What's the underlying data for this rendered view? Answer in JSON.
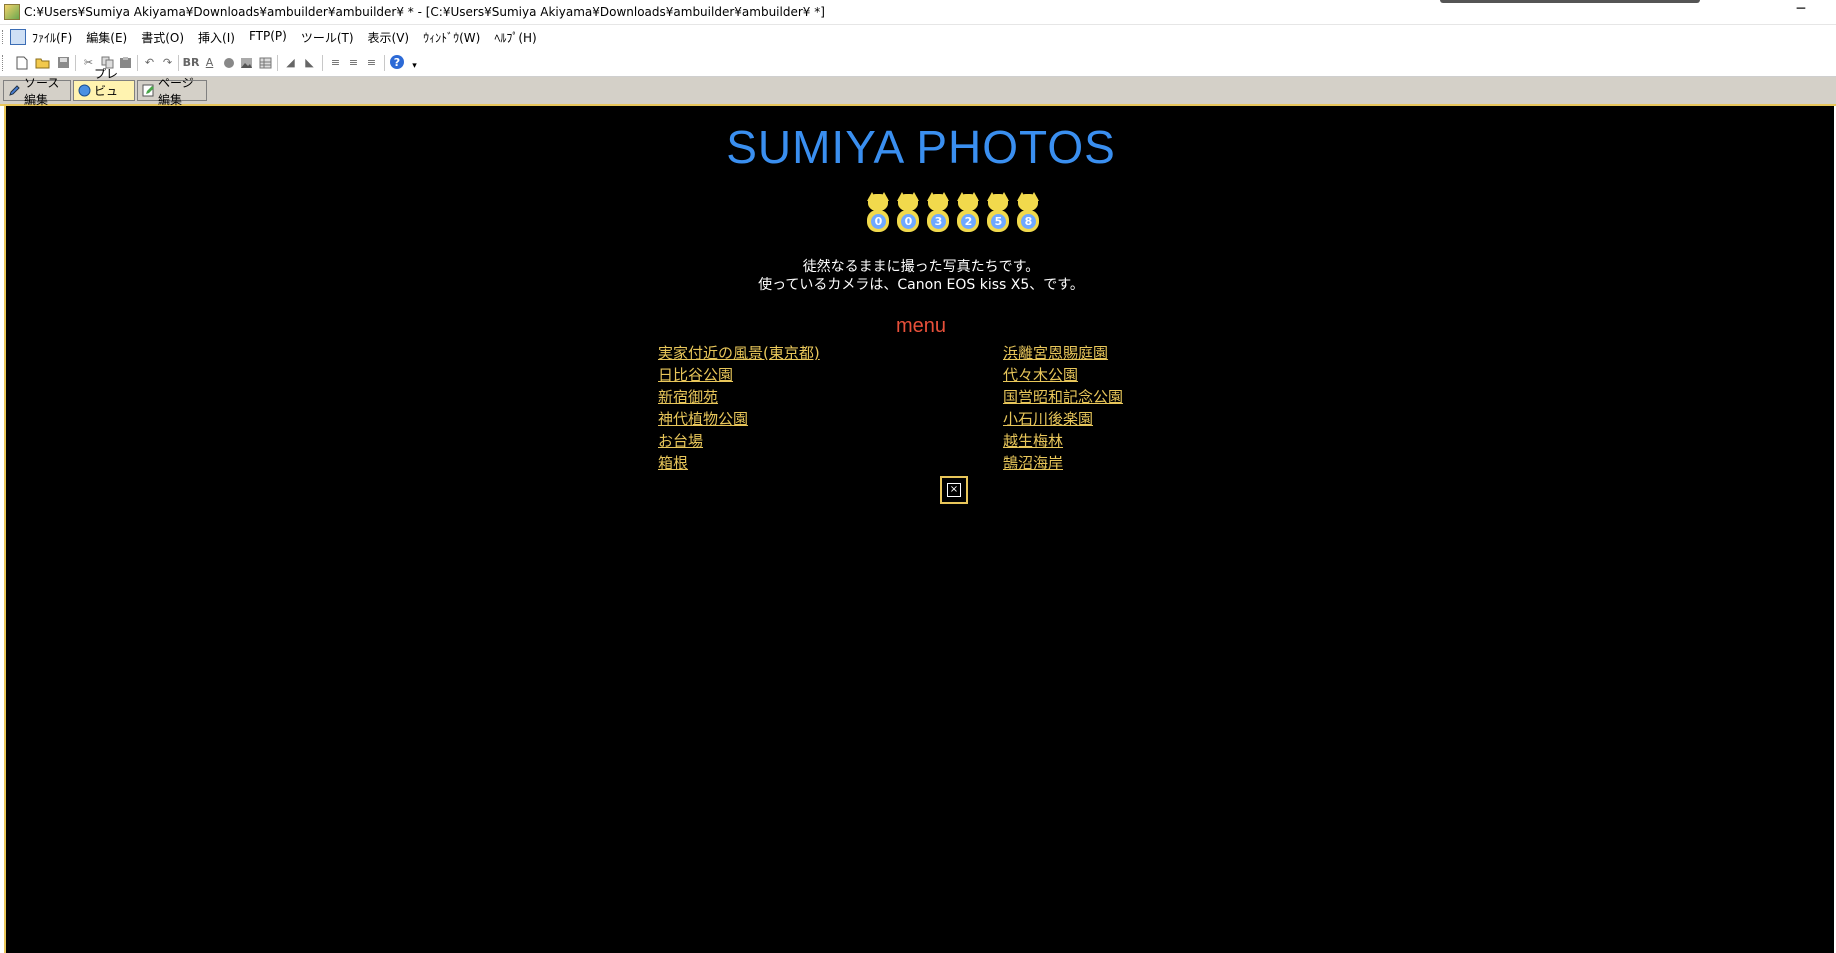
{
  "titlebar": {
    "title": "C:¥Users¥Sumiya Akiyama¥Downloads¥ambuilder¥ambuilder¥ * - [C:¥Users¥Sumiya Akiyama¥Downloads¥ambuilder¥ambuilder¥ *]",
    "minimize": "─"
  },
  "menubar": {
    "items": [
      {
        "label": "ﾌｧｲﾙ(F)"
      },
      {
        "label": "編集(E)"
      },
      {
        "label": "書式(O)"
      },
      {
        "label": "挿入(I)"
      },
      {
        "label": "FTP(P)"
      },
      {
        "label": "ツール(T)"
      },
      {
        "label": "表示(V)"
      },
      {
        "label": "ｳｨﾝﾄﾞｳ(W)"
      },
      {
        "label": "ﾍﾙﾌﾟ(H)"
      }
    ]
  },
  "toolbar": {
    "br_label": "BR",
    "font_label": "A",
    "help_label": "?"
  },
  "tabs": [
    {
      "label": "ソース編集"
    },
    {
      "label": "プレビュー"
    },
    {
      "label": "ページ編集"
    }
  ],
  "page": {
    "site_title": "SUMIYA PHOTOS",
    "counter_digits": [
      "0",
      "0",
      "3",
      "2",
      "5",
      "8"
    ],
    "description_line1": "徒然なるままに撮った写真たちです。",
    "description_line2": "使っているカメラは、Canon EOS kiss X5、です。",
    "menu_heading": "menu",
    "left_links": [
      "実家付近の風景(東京都)",
      "日比谷公園",
      "新宿御苑",
      "神代植物公園",
      "お台場",
      "箱根"
    ],
    "right_links": [
      "浜離宮恩賜庭園",
      "代々木公園",
      "国営昭和記念公園",
      "小石川後楽園",
      "越生梅林",
      "鵠沼海岸"
    ]
  },
  "colors": {
    "title_blue": "#3a8ff0",
    "link_gold": "#e8c65a",
    "menu_red": "#e8503a",
    "background": "#000000"
  }
}
